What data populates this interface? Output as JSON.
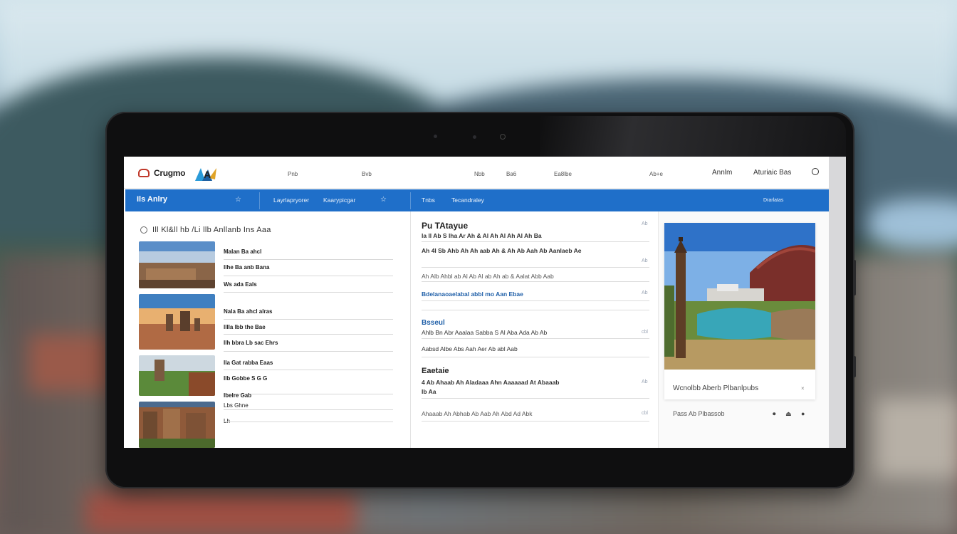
{
  "header": {
    "brand": "Crugmo",
    "links": [
      "Pnb",
      "Bvb",
      "Nbb",
      "Ba6",
      "Ea8lbe",
      "Ab+e"
    ],
    "right_text_1": "Annlm",
    "right_text_2": "Aturiaic Bas"
  },
  "navbar": {
    "home_label": "Ils Anlry",
    "items": [
      "Layrlapryorer",
      "Kaarypicgar",
      "Tnbs",
      "Tecandraley"
    ],
    "right_label": "Drarlatas",
    "icons": [
      "star-icon",
      "star-icon"
    ]
  },
  "left": {
    "heading": "Ill Kl&ll hb /Li llb Anllanb Ins Aaa",
    "articles": [
      {
        "lines": [
          "Malan Ba ahcl",
          "Ilhe Ba anb Bana",
          "Ws ada Eals"
        ]
      },
      {
        "lines": [
          "Nala Ba ahcl alras",
          "lllla lbb the Bae",
          "Ilh bbra Lb sac Ehrs"
        ]
      },
      {
        "lines": [
          "Ila Gat rabba Eaas",
          "Ilb Gobbe S G G"
        ]
      },
      {
        "lines": [
          "Ibelre Gab",
          "Lbs Ghne",
          "Lh"
        ]
      }
    ]
  },
  "middle": {
    "title": "Pu TAtayue",
    "rows": [
      "la ll Ab S lha Ar Ah & Al Ah Al Ah Al Ah Ba",
      "Ah 4l Sb Ahb Ah Ah aab Ah & Ah Ab Aah Ab Aanlaeb Ae",
      "Ah Alb Ahbl ab Al Ab Al ab Ah ab & Aalat Abb Aab",
      "Bdelanaoaelabal abbl mo Aan Ebae"
    ],
    "section_1_title": "Bsseul",
    "section_1_rows": [
      "Ahlb Bn Abr Aaalaa Sabba S Al Aba Ada Ab Ab",
      "Aabsd Albe Abs Aah Aer Ab abl Aab"
    ],
    "section_2_title": "Eaetaie",
    "section_2_rows": [
      "4 Ab Ahaab Ah Aladaaa Ahn Aaaaaad At Abaaab",
      "Ib Aa",
      "Ahaaab Ah Abhab Ab Aab Ah Abd Ad Abk"
    ],
    "meta": [
      "Ab",
      "cbl",
      "Ab"
    ]
  },
  "right": {
    "caption": "Wcnolbb Aberb Plbanlpubs",
    "footer": "Pass Ab Plbassob",
    "footer_icons": [
      "camera-icon",
      "share-icon",
      "bookmark-icon"
    ]
  },
  "colors": {
    "nav_blue": "#1f6fc9",
    "accent_red": "#c0392b",
    "link_blue": "#1f5fa8"
  }
}
